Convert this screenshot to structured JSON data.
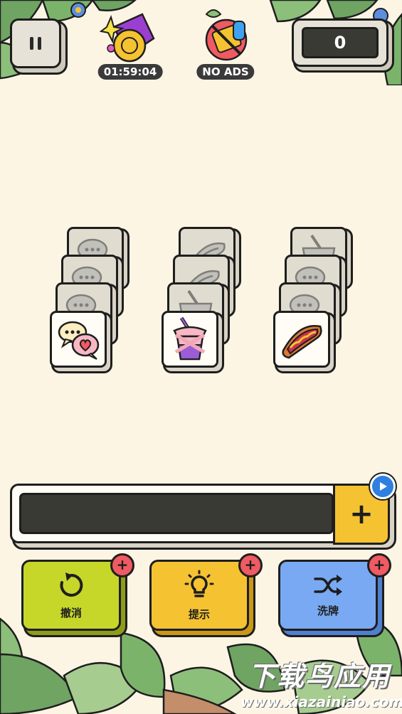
{
  "hud": {
    "timer": "01:59:04",
    "no_ads_label": "NO ADS",
    "score": "0"
  },
  "tiles": {
    "column_left_top": "speech-bubble-heart-icon",
    "column_middle_top": "bubble-tea-icon",
    "column_right_top": "hot-dog-icon"
  },
  "actions": {
    "undo_label": "撤消",
    "hint_label": "提示",
    "shuffle_label": "洗牌",
    "add_slot_symbol": "+",
    "badge_plus": "+"
  },
  "watermark": {
    "main": "下载鸟应用",
    "sub": "www.xiazainiao.com"
  },
  "colors": {
    "background": "#fdf5e4",
    "undo": "#c6d72a",
    "hint": "#f5c231",
    "shuffle": "#79a9f2",
    "badge": "#ef5a63",
    "tray_add": "#f5c231"
  }
}
